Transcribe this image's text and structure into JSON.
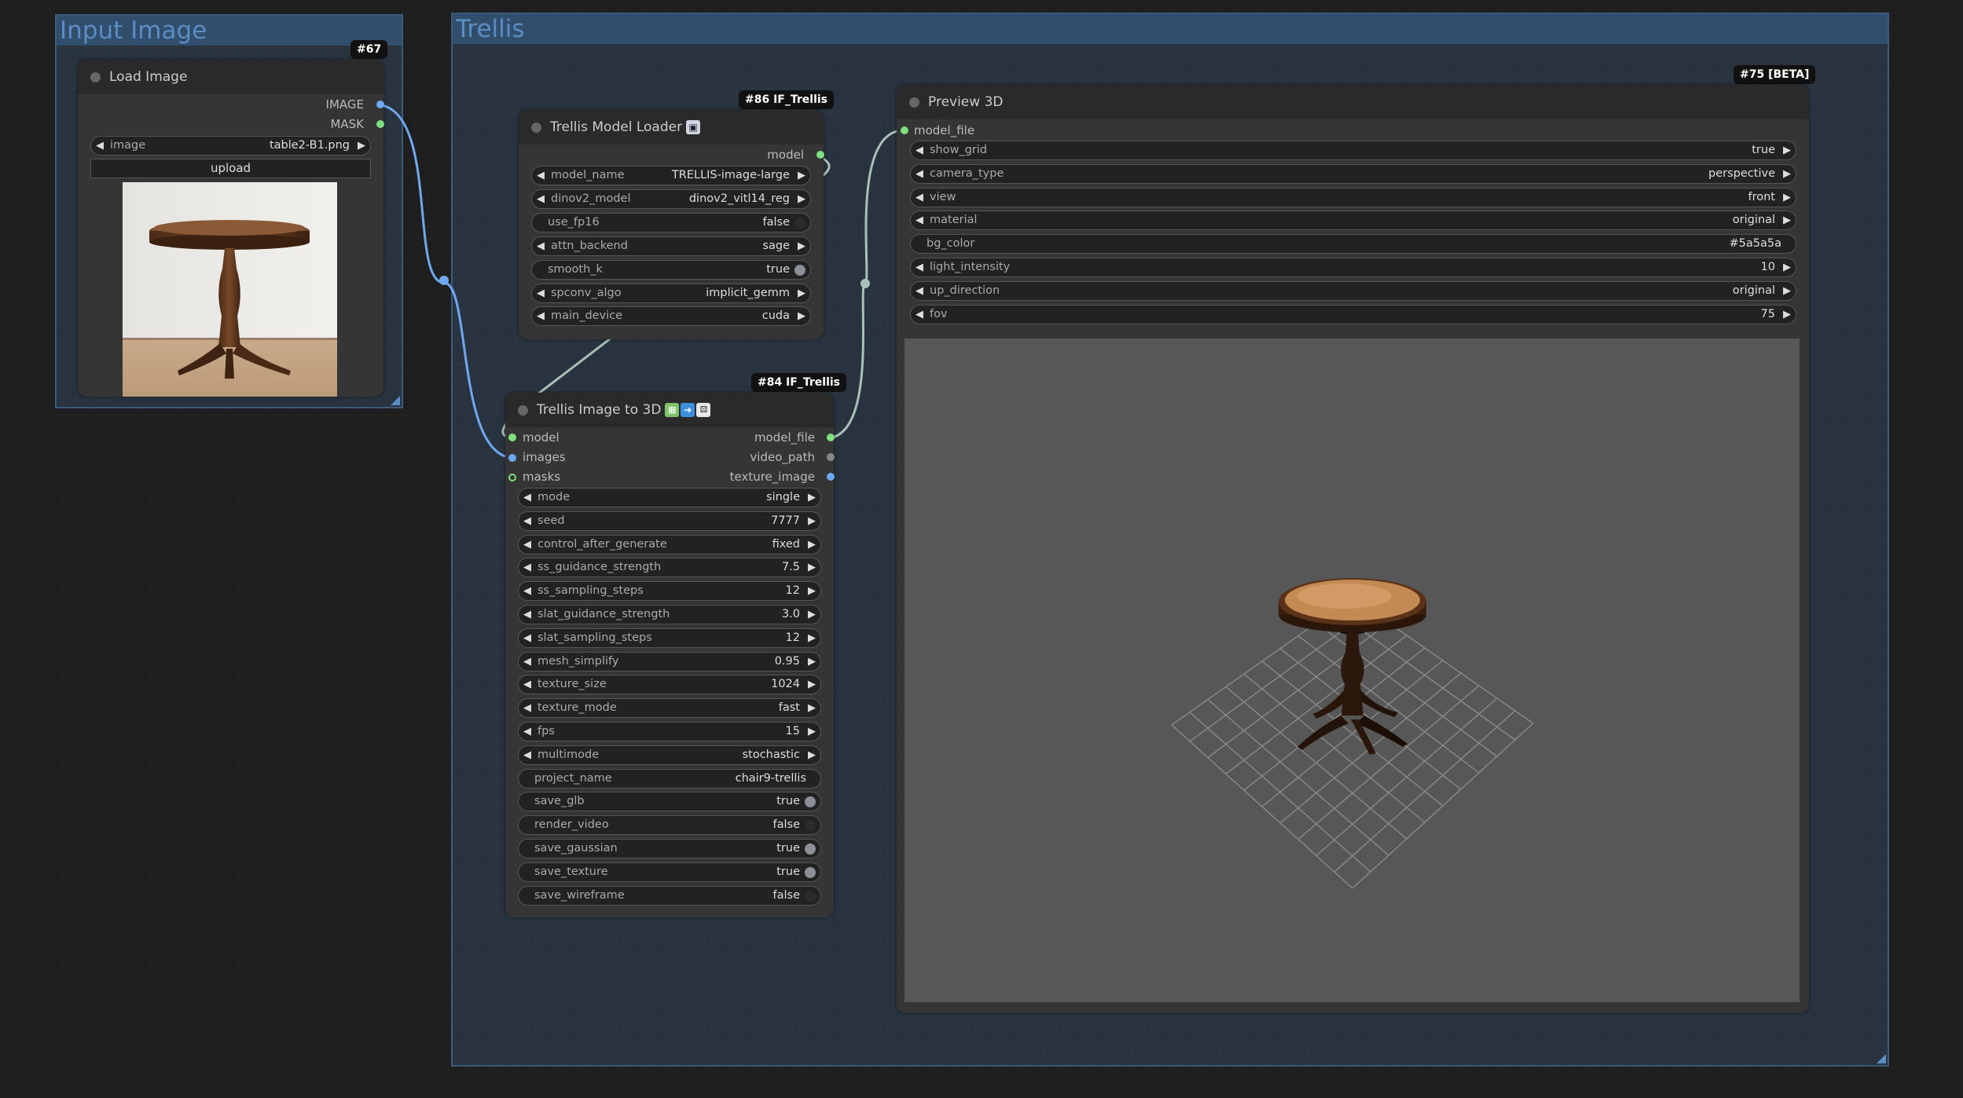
{
  "groups": {
    "input_image": {
      "title": "Input Image"
    },
    "trellis": {
      "title": "Trellis"
    }
  },
  "nodes": {
    "load_image": {
      "badge": "#67",
      "title": "Load Image",
      "outputs": [
        "IMAGE",
        "MASK"
      ],
      "image_widget": {
        "label": "image",
        "value": "table2-B1.png"
      },
      "upload_label": "upload"
    },
    "model_loader": {
      "badge": "#86 IF_Trellis",
      "title": "Trellis Model Loader",
      "title_icon": "floppy-disk-icon",
      "output": "model",
      "widgets": [
        {
          "label": "model_name",
          "value": "TRELLIS-image-large",
          "kind": "combo"
        },
        {
          "label": "dinov2_model",
          "value": "dinov2_vitl14_reg",
          "kind": "combo"
        },
        {
          "label": "use_fp16",
          "value": "false",
          "kind": "toggle"
        },
        {
          "label": "attn_backend",
          "value": "sage",
          "kind": "combo"
        },
        {
          "label": "smooth_k",
          "value": "true",
          "kind": "toggle"
        },
        {
          "label": "spconv_algo",
          "value": "implicit_gemm",
          "kind": "combo"
        },
        {
          "label": "main_device",
          "value": "cuda",
          "kind": "combo"
        }
      ]
    },
    "image_to_3d": {
      "badge": "#84 IF_Trellis",
      "title": "Trellis Image to 3D",
      "title_icons": [
        "framed-picture-icon",
        "right-arrow-icon",
        "die-icon"
      ],
      "inputs": [
        "model",
        "images",
        "masks"
      ],
      "outputs": [
        "model_file",
        "video_path",
        "texture_image"
      ],
      "widgets": [
        {
          "label": "mode",
          "value": "single",
          "kind": "combo"
        },
        {
          "label": "seed",
          "value": "7777",
          "kind": "combo"
        },
        {
          "label": "control_after_generate",
          "value": "fixed",
          "kind": "combo"
        },
        {
          "label": "ss_guidance_strength",
          "value": "7.5",
          "kind": "combo"
        },
        {
          "label": "ss_sampling_steps",
          "value": "12",
          "kind": "combo"
        },
        {
          "label": "slat_guidance_strength",
          "value": "3.0",
          "kind": "combo"
        },
        {
          "label": "slat_sampling_steps",
          "value": "12",
          "kind": "combo"
        },
        {
          "label": "mesh_simplify",
          "value": "0.95",
          "kind": "combo"
        },
        {
          "label": "texture_size",
          "value": "1024",
          "kind": "combo"
        },
        {
          "label": "texture_mode",
          "value": "fast",
          "kind": "combo"
        },
        {
          "label": "fps",
          "value": "15",
          "kind": "combo"
        },
        {
          "label": "multimode",
          "value": "stochastic",
          "kind": "combo"
        },
        {
          "label": "project_name",
          "value": "chair9-trellis",
          "kind": "text"
        },
        {
          "label": "save_glb",
          "value": "true",
          "kind": "toggle"
        },
        {
          "label": "render_video",
          "value": "false",
          "kind": "toggle"
        },
        {
          "label": "save_gaussian",
          "value": "true",
          "kind": "toggle"
        },
        {
          "label": "save_texture",
          "value": "true",
          "kind": "toggle"
        },
        {
          "label": "save_wireframe",
          "value": "false",
          "kind": "toggle"
        }
      ]
    },
    "preview_3d": {
      "badge": "#75 [BETA]",
      "title": "Preview 3D",
      "input": "model_file",
      "widgets": [
        {
          "label": "show_grid",
          "value": "true",
          "kind": "combo"
        },
        {
          "label": "camera_type",
          "value": "perspective",
          "kind": "combo"
        },
        {
          "label": "view",
          "value": "front",
          "kind": "combo"
        },
        {
          "label": "material",
          "value": "original",
          "kind": "combo"
        },
        {
          "label": "bg_color",
          "value": "#5a5a5a",
          "kind": "text"
        },
        {
          "label": "light_intensity",
          "value": "10",
          "kind": "combo"
        },
        {
          "label": "up_direction",
          "value": "original",
          "kind": "combo"
        },
        {
          "label": "fov",
          "value": "75",
          "kind": "combo"
        }
      ],
      "viewport_bg": "#575757"
    }
  },
  "colors": {
    "image_link": "#6fa8f0",
    "model_link": "#a9c0b6",
    "group_title": "#5b8cc4",
    "slot_green": "#7ee07e",
    "slot_blue": "#6fa8f0"
  }
}
